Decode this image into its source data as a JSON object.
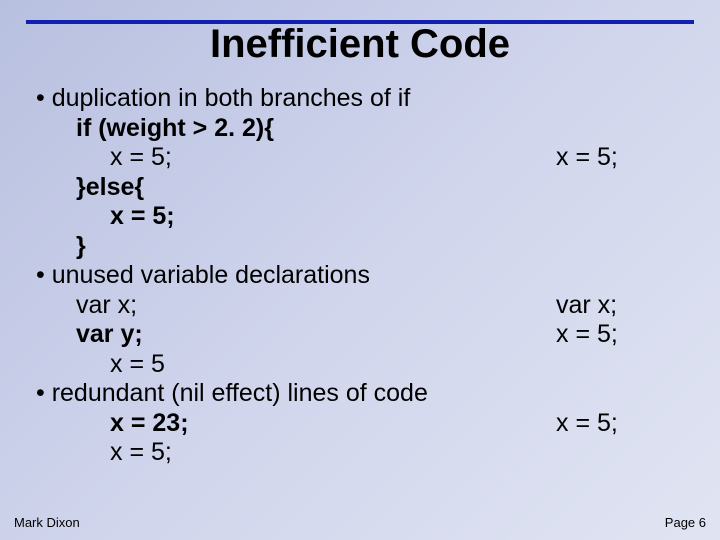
{
  "title": "Inefficient Code",
  "b1": "duplication in both branches of if",
  "c1a": "if (weight > 2. 2){",
  "c1b": "x = 5;",
  "c1c": "}else{",
  "c1d": "x = 5;",
  "c1e": "}",
  "r1": "x = 5;",
  "b2": "unused variable declarations",
  "c2a": "var x;",
  "c2b": "var y;",
  "c2c": "x = 5",
  "r2a": "var x;",
  "r2b": "x = 5;",
  "b3": "redundant (nil effect) lines of code",
  "c3a": "x = 23;",
  "c3b": "x = 5;",
  "r3": "x = 5;",
  "footer_left": "Mark Dixon",
  "footer_right": "Page 6"
}
